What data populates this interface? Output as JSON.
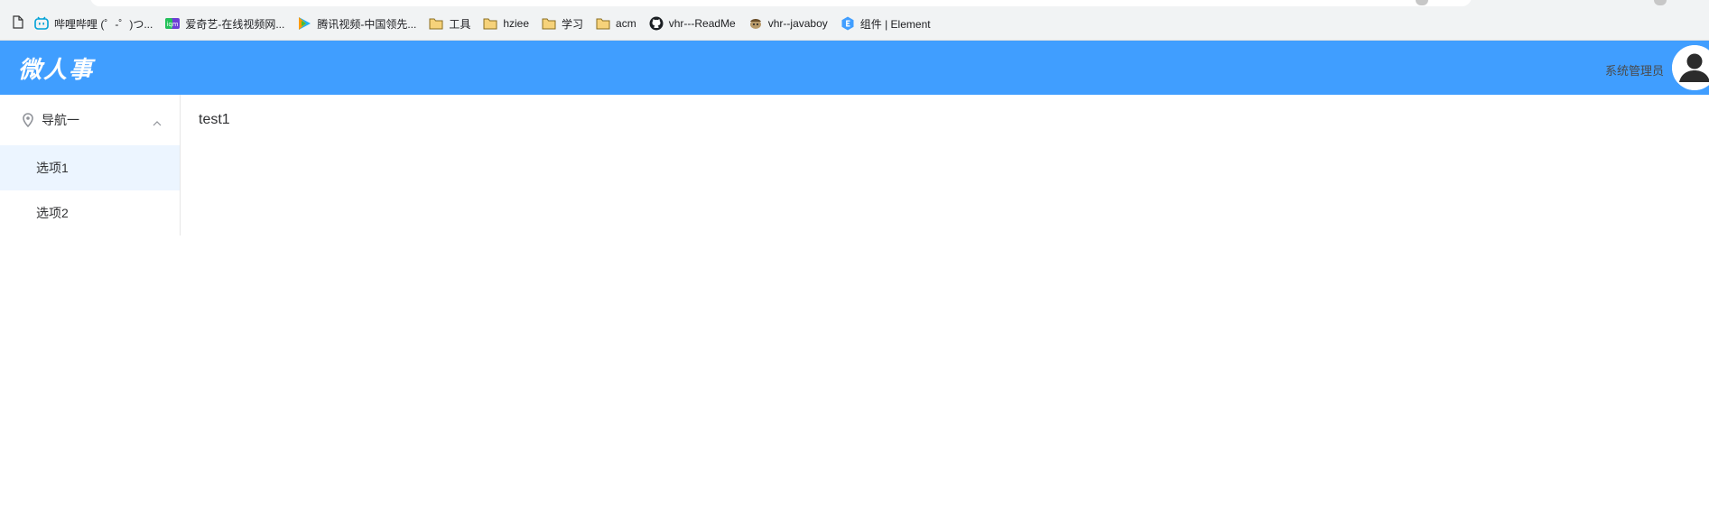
{
  "browser": {
    "bookmarks": [
      {
        "icon": "bilibili-icon",
        "label": "哔哩哔哩 (゜-゜)つ..."
      },
      {
        "icon": "iqiyi-icon",
        "label": "爱奇艺-在线视频网..."
      },
      {
        "icon": "tencent-video-icon",
        "label": "腾讯视频-中国领先..."
      },
      {
        "icon": "folder-icon",
        "label": "工具"
      },
      {
        "icon": "folder-icon",
        "label": "hziee"
      },
      {
        "icon": "folder-icon",
        "label": "学习"
      },
      {
        "icon": "folder-icon",
        "label": "acm"
      },
      {
        "icon": "github-icon",
        "label": "vhr---ReadMe"
      },
      {
        "icon": "javaboy-icon",
        "label": "vhr--javaboy"
      },
      {
        "icon": "element-icon",
        "label": "组件 | Element"
      }
    ],
    "iqiyi_badge": "iqm"
  },
  "header": {
    "logo": "微人事",
    "user_name": "系统管理员",
    "brand_color": "#409eff"
  },
  "sidebar": {
    "group": {
      "label": "导航一",
      "icon": "location-pin-icon",
      "expanded": true
    },
    "items": [
      {
        "label": "选项1",
        "active": true
      },
      {
        "label": "选项2",
        "active": false
      }
    ]
  },
  "main": {
    "content": "test1"
  }
}
